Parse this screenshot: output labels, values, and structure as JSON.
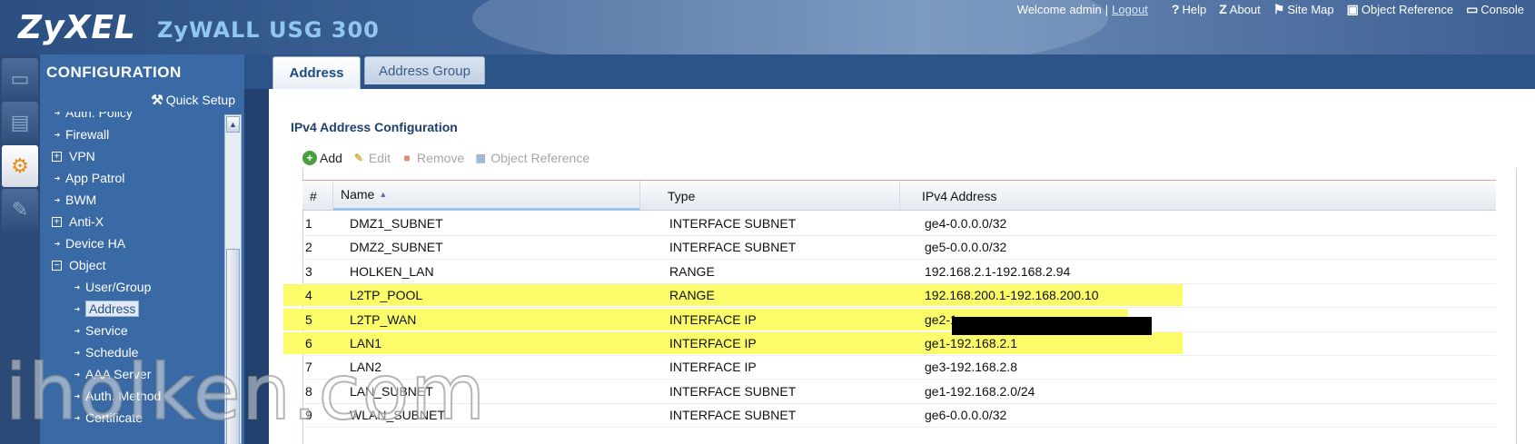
{
  "header": {
    "logo": "ZyXEL",
    "product": "ZyWALL USG 300",
    "welcome": "Welcome admin",
    "separator": "|",
    "logout": "Logout",
    "links": [
      {
        "icon": "help-icon",
        "glyph": "?",
        "label": "Help"
      },
      {
        "icon": "about-icon",
        "glyph": "Z",
        "label": "About"
      },
      {
        "icon": "site-map-icon",
        "glyph": "⚑",
        "label": "Site Map"
      },
      {
        "icon": "object-reference-icon",
        "glyph": "▣",
        "label": "Object Reference"
      },
      {
        "icon": "console-icon",
        "glyph": "▭",
        "label": "Console"
      }
    ]
  },
  "sidebar": {
    "title": "CONFIGURATION",
    "quick_setup": "Quick Setup",
    "items": [
      {
        "label": "Auth. Policy",
        "type": "bullet",
        "level": 0
      },
      {
        "label": "Firewall",
        "type": "bullet",
        "level": 0
      },
      {
        "label": "VPN",
        "type": "expand",
        "level": 0
      },
      {
        "label": "App Patrol",
        "type": "bullet",
        "level": 0
      },
      {
        "label": "BWM",
        "type": "bullet",
        "level": 0
      },
      {
        "label": "Anti-X",
        "type": "expand",
        "level": 0
      },
      {
        "label": "Device HA",
        "type": "bullet",
        "level": 0
      },
      {
        "label": "Object",
        "type": "collapse",
        "level": 0
      },
      {
        "label": "User/Group",
        "type": "bullet",
        "level": 1
      },
      {
        "label": "Address",
        "type": "bullet",
        "level": 1,
        "selected": true
      },
      {
        "label": "Service",
        "type": "bullet",
        "level": 1
      },
      {
        "label": "Schedule",
        "type": "bullet",
        "level": 1
      },
      {
        "label": "AAA Server",
        "type": "bullet",
        "level": 1
      },
      {
        "label": "Auth. Method",
        "type": "bullet",
        "level": 1
      },
      {
        "label": "Certificate",
        "type": "bullet",
        "level": 1
      }
    ]
  },
  "tabs": [
    {
      "label": "Address",
      "active": true
    },
    {
      "label": "Address Group",
      "active": false
    }
  ],
  "section_title": "IPv4 Address Configuration",
  "toolbar": {
    "add": "Add",
    "edit": "Edit",
    "remove": "Remove",
    "object_reference": "Object Reference"
  },
  "table": {
    "columns": [
      "#",
      "Name",
      "Type",
      "IPv4 Address"
    ],
    "rows": [
      {
        "num": "1",
        "name": "DMZ1_SUBNET",
        "type": "INTERFACE SUBNET",
        "address": "ge4-0.0.0.0/32",
        "highlight": false
      },
      {
        "num": "2",
        "name": "DMZ2_SUBNET",
        "type": "INTERFACE SUBNET",
        "address": "ge5-0.0.0.0/32",
        "highlight": false
      },
      {
        "num": "3",
        "name": "HOLKEN_LAN",
        "type": "RANGE",
        "address": "192.168.2.1-192.168.2.94",
        "highlight": false
      },
      {
        "num": "4",
        "name": "L2TP_POOL",
        "type": "RANGE",
        "address": "192.168.200.1-192.168.200.10",
        "highlight": true
      },
      {
        "num": "5",
        "name": "L2TP_WAN",
        "type": "INTERFACE IP",
        "address": "ge2-1",
        "highlight": true
      },
      {
        "num": "6",
        "name": "LAN1",
        "type": "INTERFACE IP",
        "address": "ge1-192.168.2.1",
        "highlight": true
      },
      {
        "num": "7",
        "name": "LAN2",
        "type": "INTERFACE IP",
        "address": "ge3-192.168.2.8",
        "highlight": false
      },
      {
        "num": "8",
        "name": "LAN_SUBNET",
        "type": "INTERFACE SUBNET",
        "address": "ge1-192.168.2.0/24",
        "highlight": false
      },
      {
        "num": "9",
        "name": "WLAN_SUBNET",
        "type": "INTERFACE SUBNET",
        "address": "ge6-0.0.0.0/32",
        "highlight": false
      }
    ]
  },
  "watermark": "iholken.com",
  "colors": {
    "highlight": "#fcfc6a",
    "header_bg": "#3f6498",
    "sidebar_bg": "#3a6aa5"
  }
}
